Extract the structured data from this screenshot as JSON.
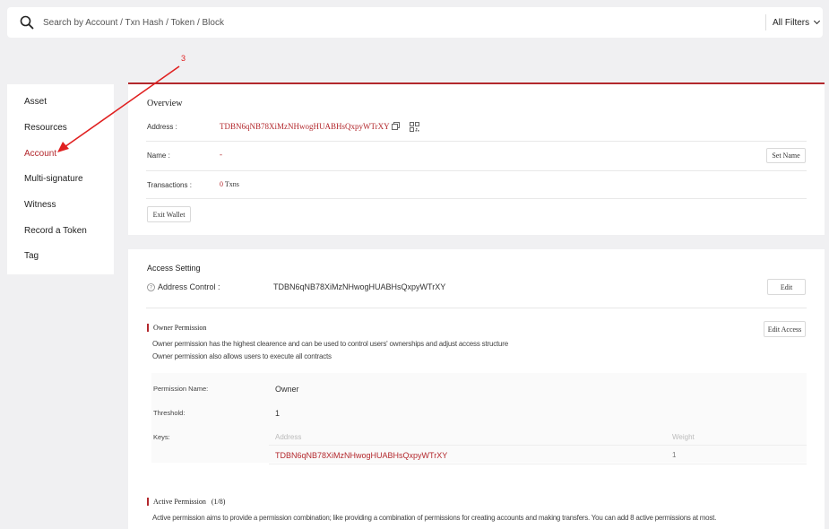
{
  "search": {
    "placeholder": "Search by Account / Txn Hash / Token / Block",
    "filter_label": "All Filters"
  },
  "sidebar": {
    "items": [
      {
        "label": "Asset"
      },
      {
        "label": "Resources"
      },
      {
        "label": "Account"
      },
      {
        "label": "Multi-signature"
      },
      {
        "label": "Witness"
      },
      {
        "label": "Record a Token"
      },
      {
        "label": "Tag"
      }
    ],
    "active": "Account"
  },
  "annotation": {
    "step": "3"
  },
  "overview": {
    "title": "Overview",
    "address_label": "Address :",
    "address_value": "TDBN6qNB78XiMzNHwogHUABHsQxpyWTrXY",
    "name_label": "Name :",
    "name_value": "-",
    "set_name_button": "Set Name",
    "transactions_label": "Transactions :",
    "txn_count": "0",
    "txn_unit": "Txns",
    "exit_wallet_button": "Exit Wallet"
  },
  "access": {
    "title": "Access Setting",
    "address_control_label": "Address Control :",
    "address_control_value": "TDBN6qNB78XiMzNHwogHUABHsQxpyWTrXY",
    "edit_button": "Edit",
    "owner": {
      "title": "Owner Permission",
      "edit_access_button": "Edit Access",
      "desc1": "Owner permission has the highest clearence and can be used to control users' ownerships and adjust access structure",
      "desc2": "Owner permission also allows users to execute all contracts",
      "permission_name_label": "Permission Name:",
      "permission_name_value": "Owner",
      "threshold_label": "Threshold:",
      "threshold_value": "1",
      "keys_label": "Keys:",
      "col_address": "Address",
      "col_weight": "Weight",
      "key_address": "TDBN6qNB78XiMzNHwogHUABHsQxpyWTrXY",
      "key_weight": "1"
    },
    "active": {
      "title": "Active Permission",
      "count": "(1/8)",
      "desc": "Active permission aims to provide a permission combination; like providing a combination of permissions for creating accounts and making transfers. You can add 8 active permissions at most."
    }
  },
  "colors": {
    "accent": "#b3282d",
    "background": "#f0f0f2"
  }
}
